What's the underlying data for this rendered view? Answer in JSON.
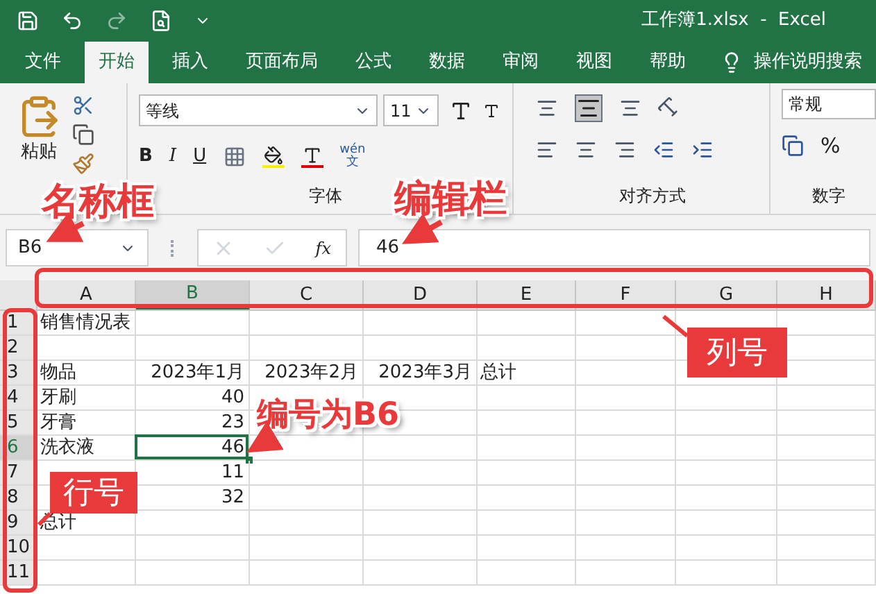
{
  "title_bar": {
    "title": "工作簿1.xlsx  -  Excel"
  },
  "menu_tabs": [
    {
      "label": "文件",
      "selected": false
    },
    {
      "label": "开始",
      "selected": true
    },
    {
      "label": "插入",
      "selected": false
    },
    {
      "label": "页面布局",
      "selected": false
    },
    {
      "label": "公式",
      "selected": false
    },
    {
      "label": "数据",
      "selected": false
    },
    {
      "label": "审阅",
      "selected": false
    },
    {
      "label": "视图",
      "selected": false
    },
    {
      "label": "帮助",
      "selected": false
    }
  ],
  "search": {
    "label": "操作说明搜索"
  },
  "ribbon": {
    "clipboard": {
      "paste_label": "粘贴"
    },
    "font": {
      "font_name": "等线",
      "font_size": "11",
      "bold": "B",
      "italic": "I",
      "underline": "U",
      "phonetic_top": "wén",
      "phonetic_bottom": "文",
      "group_label": "字体"
    },
    "alignment": {
      "group_label": "对齐方式"
    },
    "number": {
      "format": "常规",
      "percent": "%",
      "group_label": "数字"
    }
  },
  "formula_bar": {
    "name_box": "B6",
    "fx": "fx",
    "value": "46"
  },
  "sheet": {
    "columns": [
      {
        "label": "A",
        "selected": false
      },
      {
        "label": "B",
        "selected": true
      },
      {
        "label": "C",
        "selected": false
      },
      {
        "label": "D",
        "selected": false
      },
      {
        "label": "E",
        "selected": false
      },
      {
        "label": "F",
        "selected": false
      },
      {
        "label": "G",
        "selected": false
      },
      {
        "label": "H",
        "selected": false
      }
    ],
    "rows": [
      {
        "label": "1",
        "selected": false,
        "cells": [
          {
            "text": "销售情况表",
            "kind": "text"
          }
        ]
      },
      {
        "label": "2",
        "selected": false
      },
      {
        "label": "3",
        "selected": false,
        "cells": [
          {
            "text": "物品",
            "kind": "text"
          },
          {
            "text": "2023年1月",
            "kind": "number"
          },
          {
            "text": "2023年2月",
            "kind": "number"
          },
          {
            "text": "2023年3月",
            "kind": "number"
          },
          {
            "text": "总计",
            "kind": "text"
          }
        ]
      },
      {
        "label": "4",
        "selected": false,
        "cells": [
          {
            "text": "牙刷",
            "kind": "text"
          },
          {
            "text": "40",
            "kind": "number"
          }
        ]
      },
      {
        "label": "5",
        "selected": false,
        "cells": [
          {
            "text": "牙膏",
            "kind": "text"
          },
          {
            "text": "23",
            "kind": "number"
          }
        ]
      },
      {
        "label": "6",
        "selected": true,
        "cells": [
          {
            "text": "洗衣液",
            "kind": "text"
          },
          {
            "text": "46",
            "kind": "number"
          }
        ]
      },
      {
        "label": "7",
        "selected": false,
        "cells": [
          {
            "kind": "hidden"
          },
          {
            "text": "11",
            "kind": "number"
          }
        ]
      },
      {
        "label": "8",
        "selected": false,
        "cells": [
          {
            "kind": "hidden"
          },
          {
            "text": "32",
            "kind": "number"
          }
        ]
      },
      {
        "label": "9",
        "selected": false,
        "cells": [
          {
            "text": "总计",
            "kind": "text"
          }
        ]
      },
      {
        "label": "10",
        "selected": false
      },
      {
        "label": "11",
        "selected": false
      }
    ]
  },
  "annotations": {
    "name_box_label": "名称框",
    "formula_bar_label": "编辑栏",
    "column_label": "列号",
    "cell_label": "编号为B6",
    "row_label": "行号"
  }
}
